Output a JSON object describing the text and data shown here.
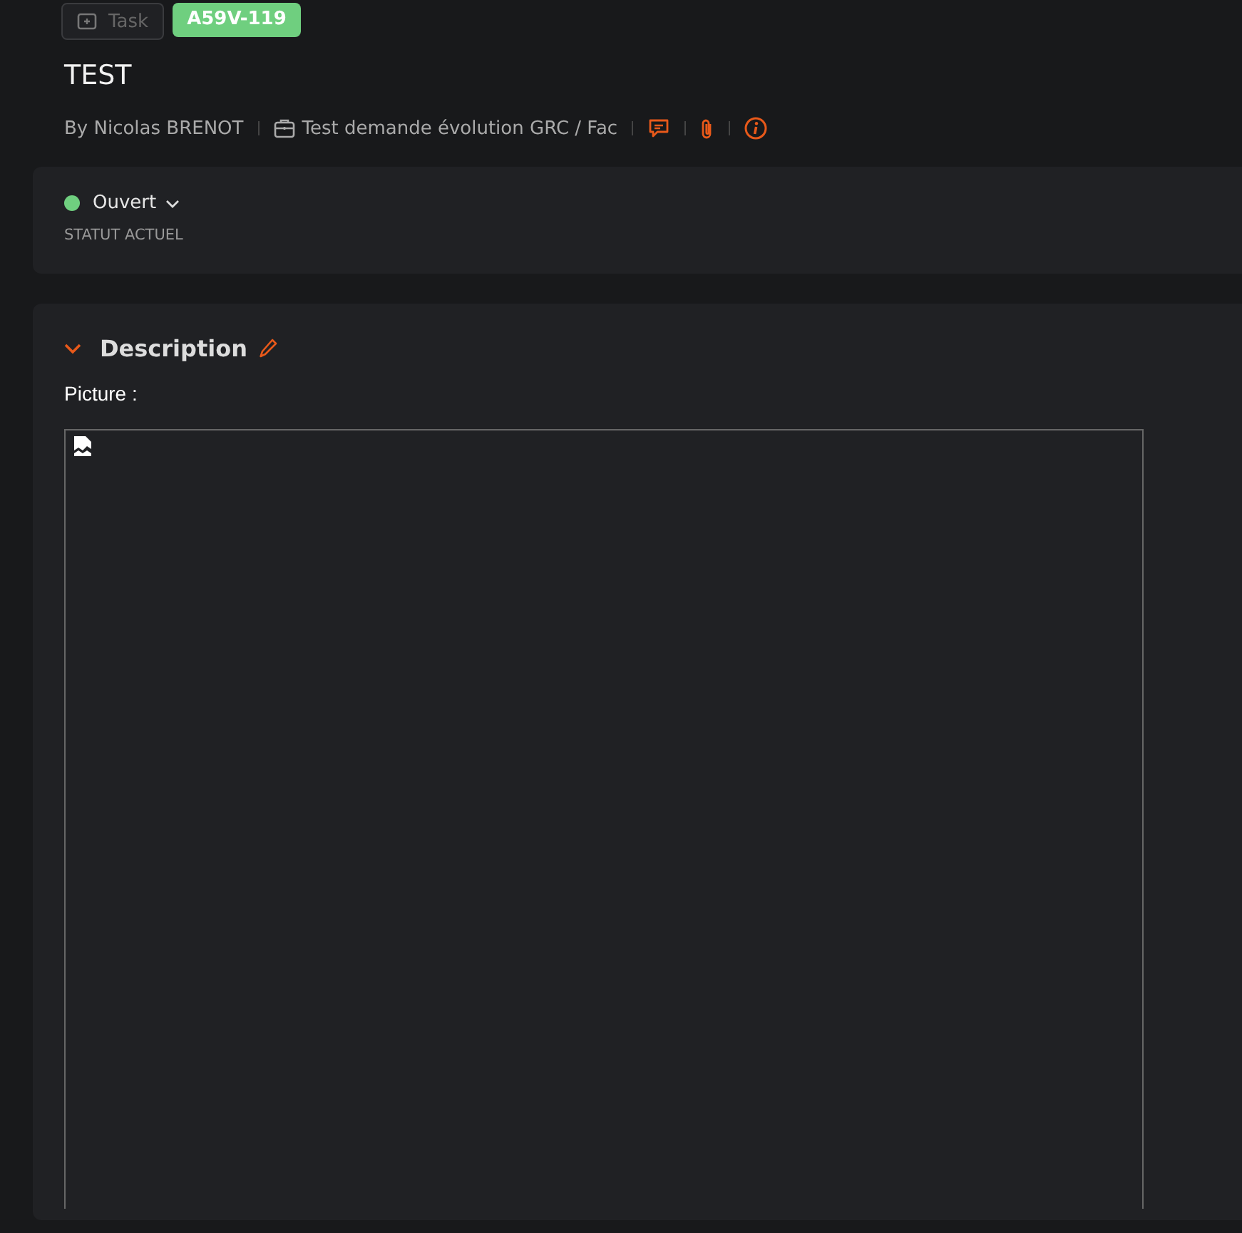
{
  "header": {
    "type_tag": "Task",
    "id_badge": "A59V-119",
    "title": "TEST",
    "author": "By Nicolas BRENOT",
    "project": "Test demande évolution GRC / Fac"
  },
  "status": {
    "value": "Ouvert",
    "label": "STATUT ACTUEL",
    "color": "#6fcf7f"
  },
  "description": {
    "title": "Description",
    "expanded": true,
    "text": "Picture :",
    "image": {
      "broken": true
    }
  }
}
